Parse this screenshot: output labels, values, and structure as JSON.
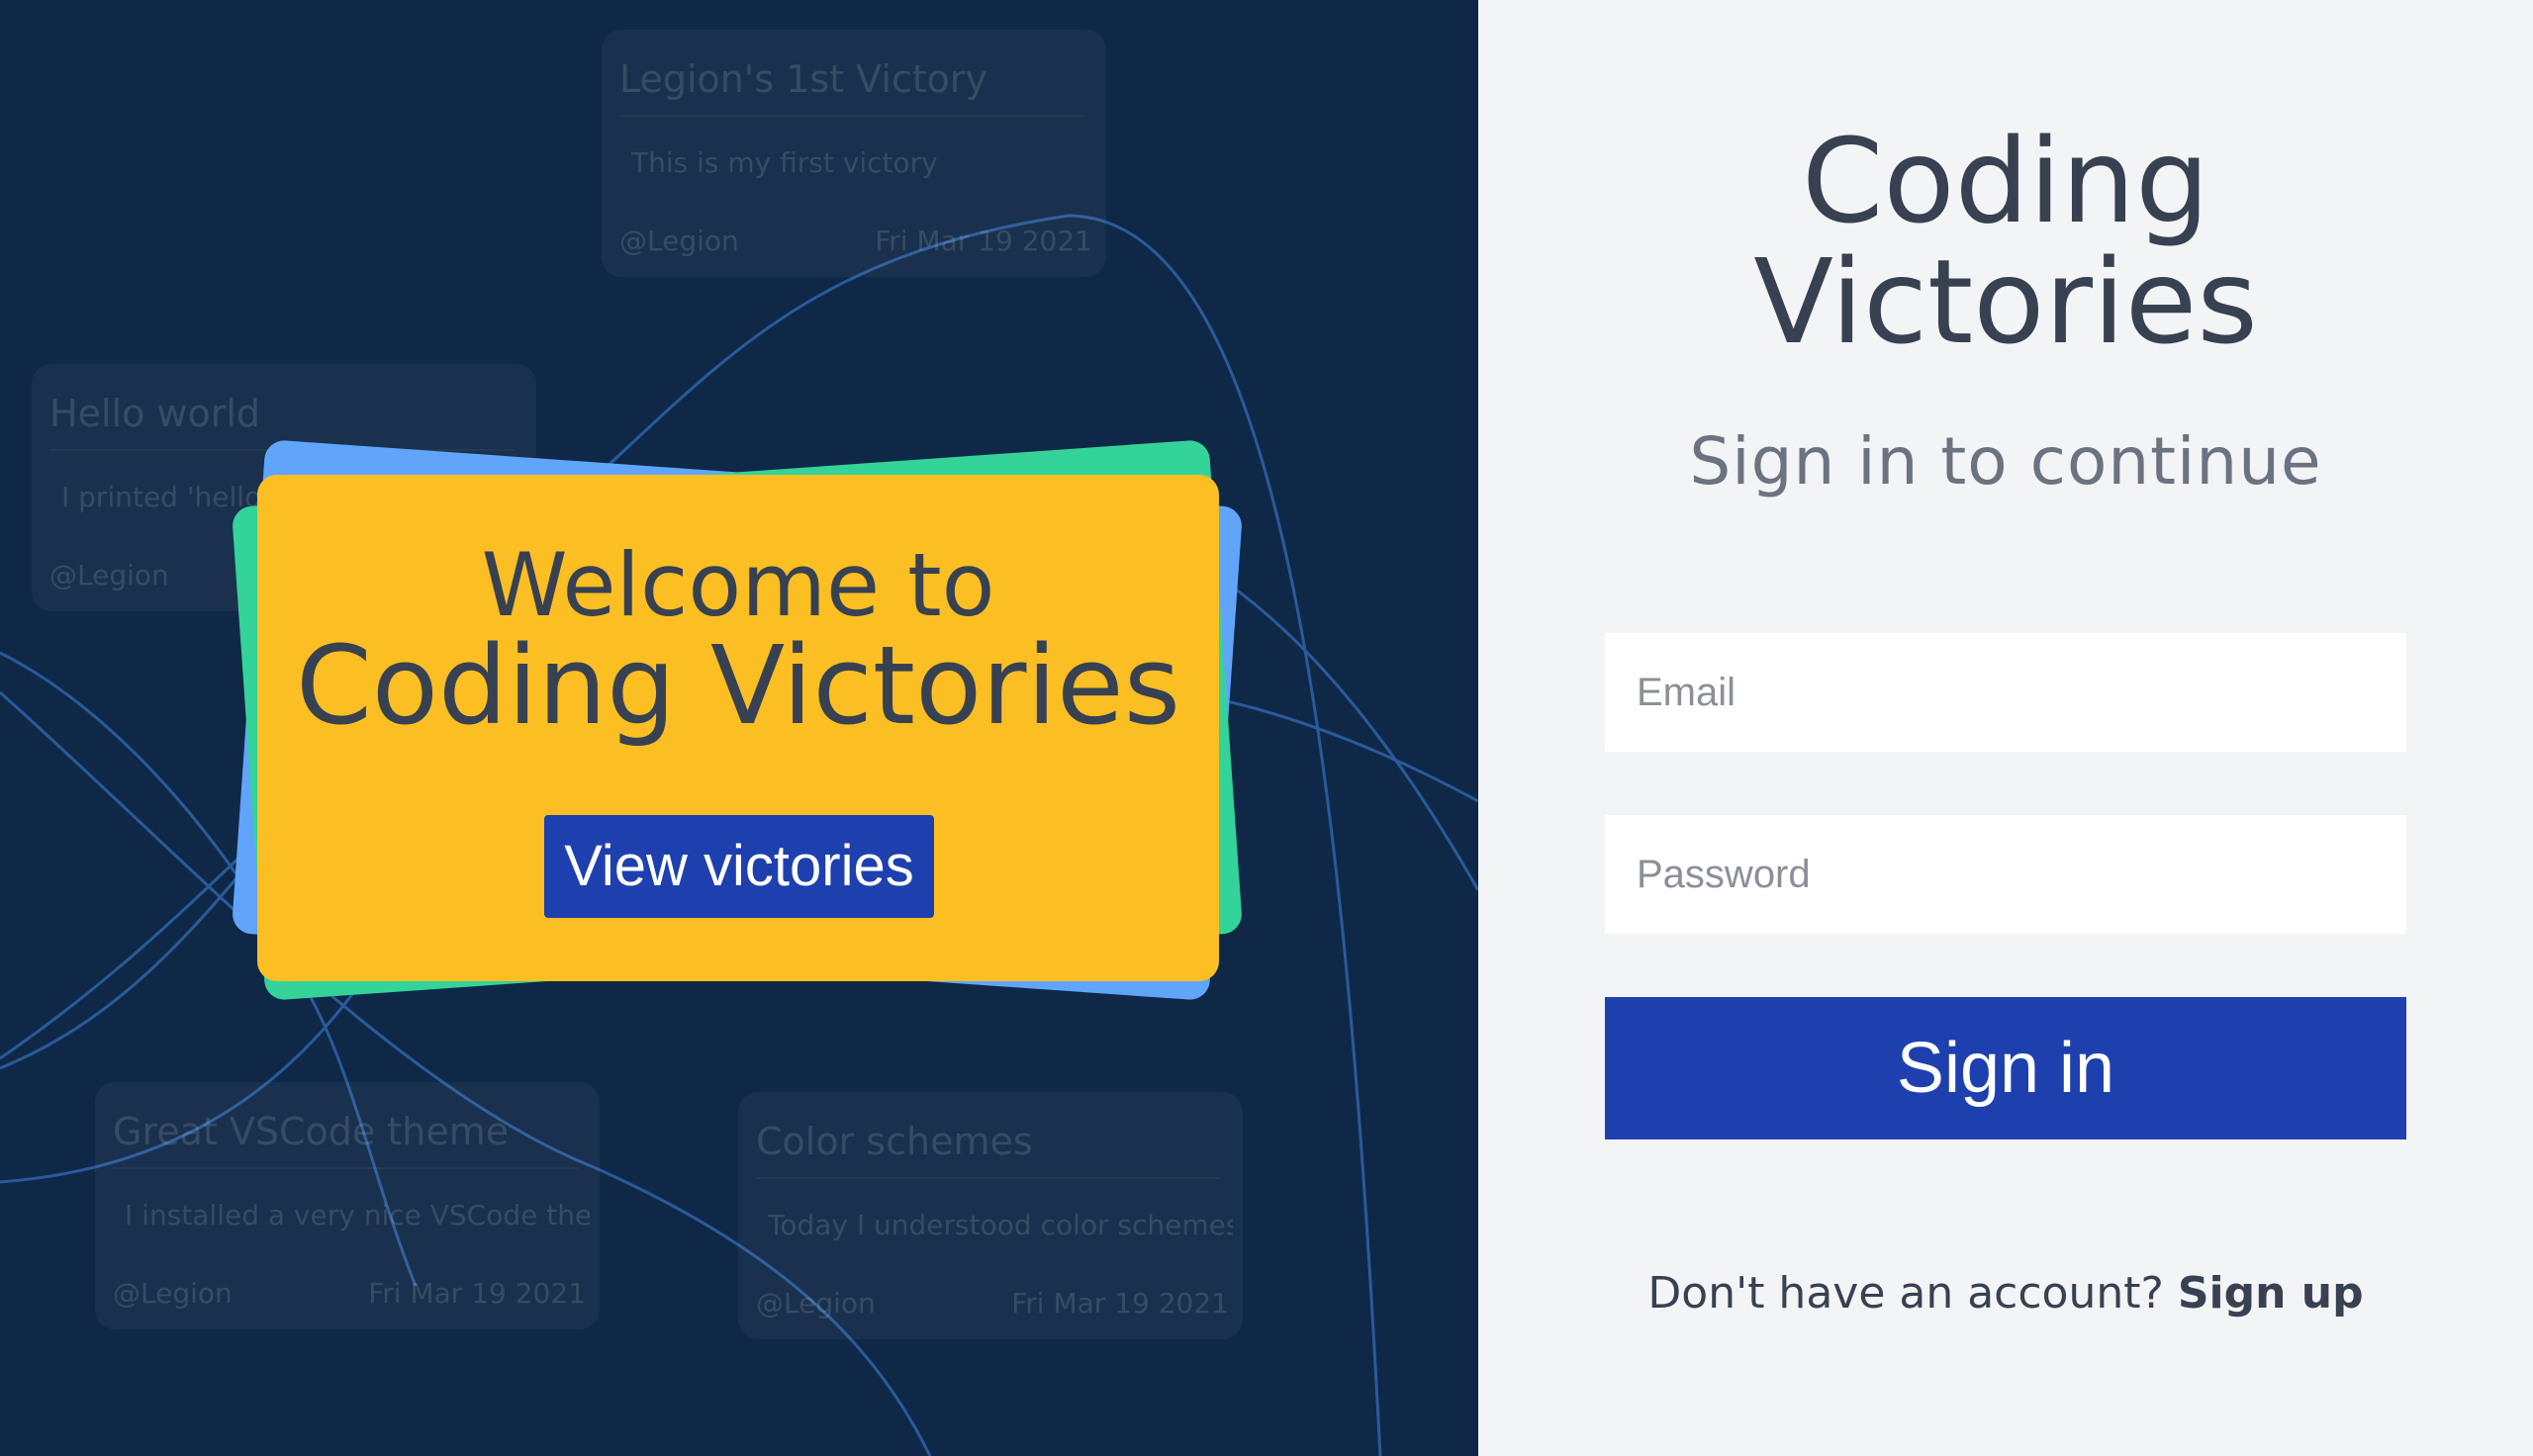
{
  "colors": {
    "left_background": "#0f2847",
    "right_background": "#f3f4f6",
    "accent_blue": "#1e40af",
    "card_yellow": "#fbbf24",
    "card_green": "#34d399",
    "card_light_blue": "#60a5fa",
    "line_color": "#2a5a9a"
  },
  "background_cards": [
    {
      "title": "Legion's 1st Victory",
      "body": "This is my first victory",
      "author": "@Legion",
      "date": "Fri Mar 19 2021"
    },
    {
      "title": "Hello world",
      "body": "I printed 'hello world'",
      "author": "@Legion",
      "date": ""
    },
    {
      "title": "Great VSCode theme",
      "body": "I installed a very nice VSCode theme",
      "author": "@Legion",
      "date": "Fri Mar 19 2021"
    },
    {
      "title": "Color schemes",
      "body": "Today I understood color schemes",
      "author": "@Legion",
      "date": "Fri Mar 19 2021"
    }
  ],
  "welcome": {
    "line1": "Welcome to",
    "line2": "Coding Victories",
    "button_label": "View victories"
  },
  "auth": {
    "title_line1": "Coding",
    "title_line2": "Victories",
    "subtitle": "Sign in to continue",
    "email_placeholder": "Email",
    "password_placeholder": "Password",
    "sign_in_label": "Sign in",
    "no_account_text": "Don't have an account?",
    "sign_up_label": "Sign up"
  }
}
